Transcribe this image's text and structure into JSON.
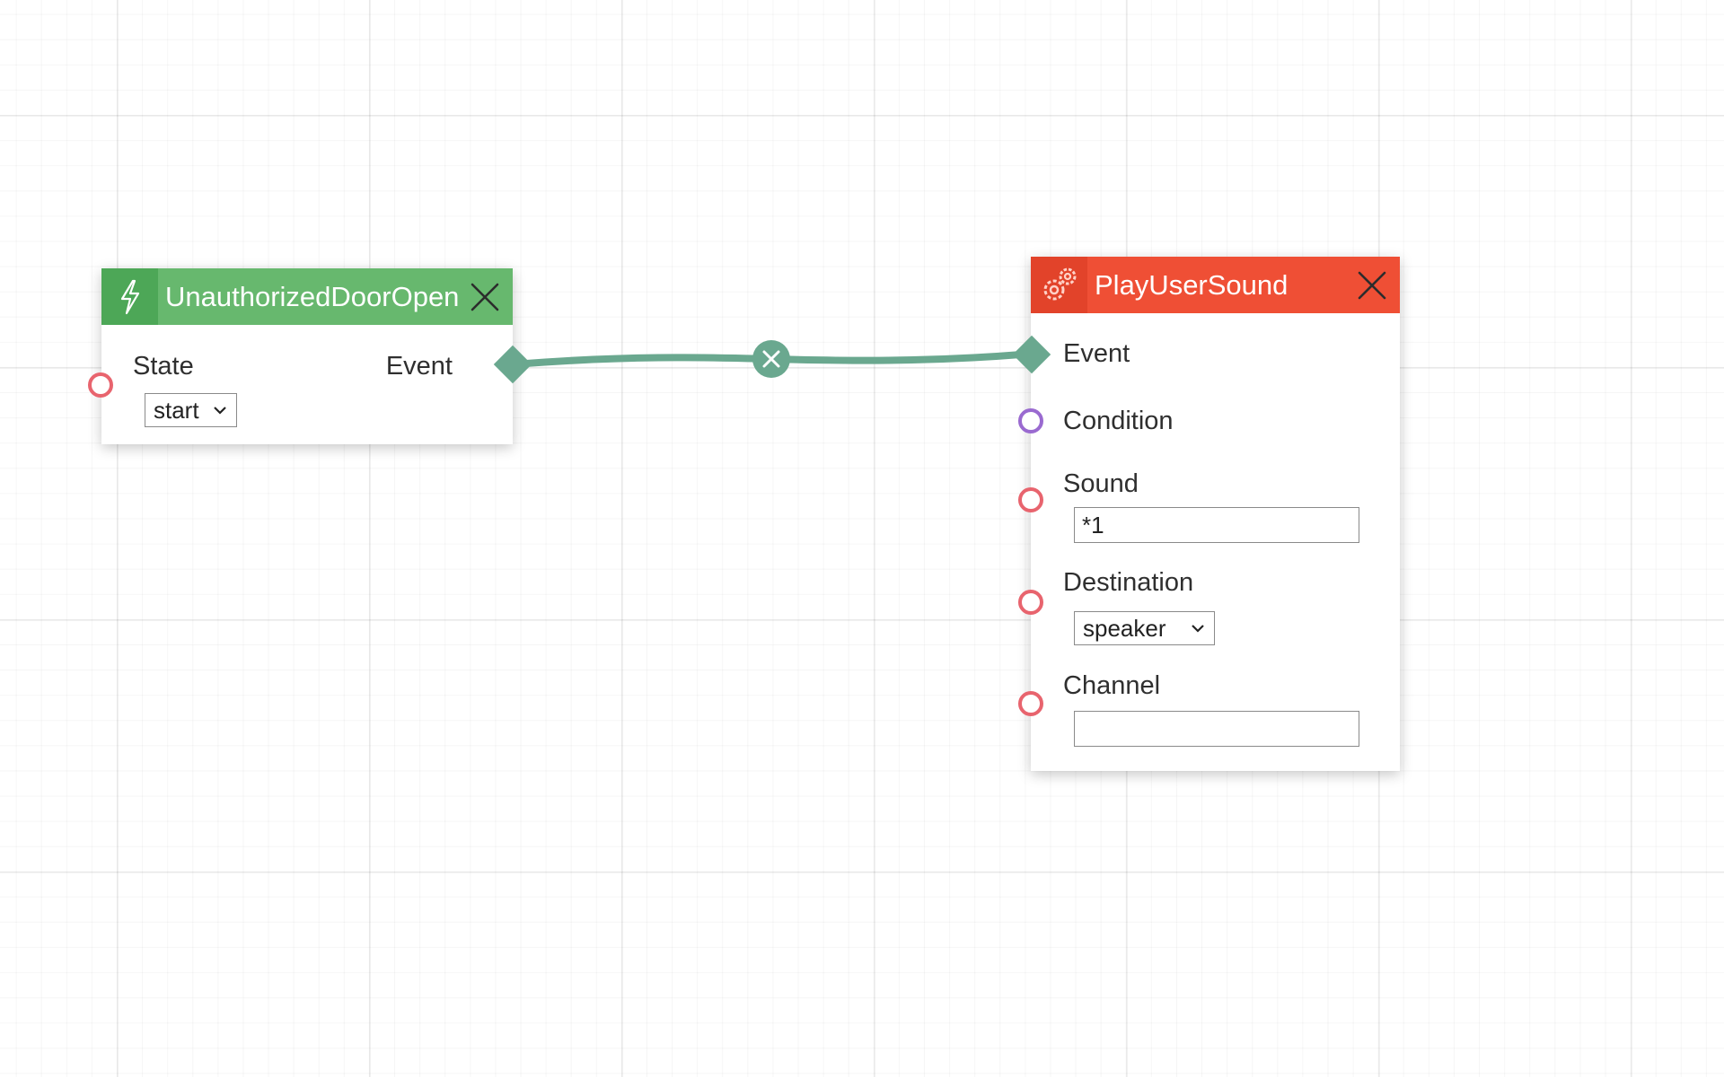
{
  "colors": {
    "event_header": "#67b86e",
    "event_icon_bg": "#4da757",
    "action_header": "#ef4f35",
    "action_icon_bg": "#e2432a",
    "wire": "#6aa88f",
    "input_port": "#e8646e",
    "condition_port": "#9a6ad0"
  },
  "nodes": {
    "event_node": {
      "title": "UnauthorizedDoorOpen",
      "icon": "lightning-bolt-icon",
      "state_label": "State",
      "state_value": "start",
      "event_label": "Event"
    },
    "action_node": {
      "title": "PlayUserSound",
      "icon": "gears-icon",
      "event_label": "Event",
      "condition_label": "Condition",
      "sound_label": "Sound",
      "sound_value": "*1",
      "destination_label": "Destination",
      "destination_value": "speaker",
      "channel_label": "Channel",
      "channel_value": ""
    }
  },
  "wire": {
    "from": "UnauthorizedDoorOpen.Event",
    "to": "PlayUserSound.Event",
    "delete_icon": "close-icon"
  }
}
